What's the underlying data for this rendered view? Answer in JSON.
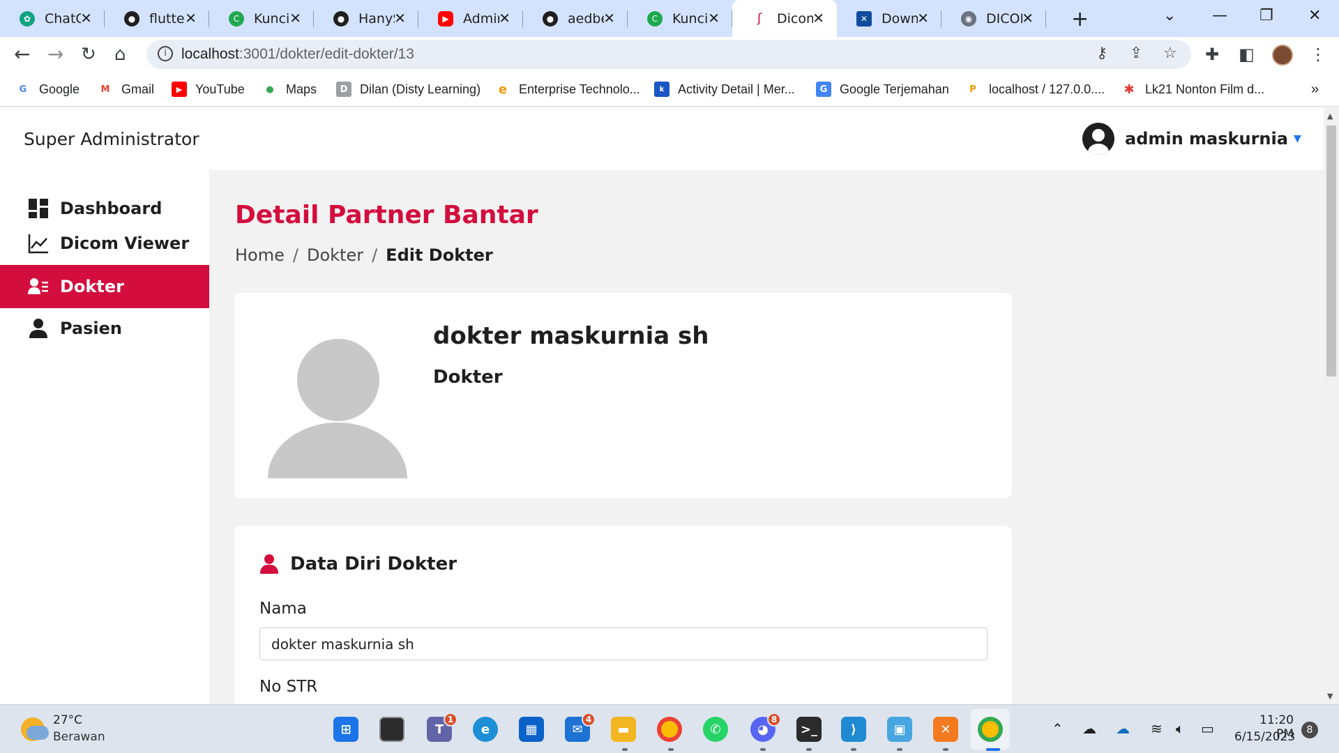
{
  "browser": {
    "tabs": [
      {
        "title": "ChatGPT",
        "icon": "chatgpt-icon",
        "color": "#10a37f"
      },
      {
        "title": "flutter-",
        "icon": "github-icon",
        "color": "#1f1f1f"
      },
      {
        "title": "Kunci Jawaban",
        "icon": "kunci-icon",
        "color": "#1fa84f"
      },
      {
        "title": "HanySu",
        "icon": "github-icon",
        "color": "#1f1f1f"
      },
      {
        "title": "Admin",
        "icon": "youtube-icon",
        "color": "#ff0000"
      },
      {
        "title": "aedbel",
        "icon": "github-icon",
        "color": "#1f1f1f"
      },
      {
        "title": "Kunci Jawaban",
        "icon": "kunci-icon",
        "color": "#1fa84f"
      },
      {
        "title": "Dicom",
        "icon": "dicom-icon",
        "color": "#d30d3d"
      },
      {
        "title": "Download",
        "icon": "download-icon",
        "color": "#0f4c9b"
      },
      {
        "title": "DICOM",
        "icon": "dicom-globe-icon",
        "color": "#6b7280"
      }
    ],
    "close_glyph": "✕",
    "new_tab_glyph": "+",
    "url_host": "localhost",
    "url_path": ":3001/dokter/edit-dokter/13",
    "info_glyph": "i",
    "bookmarks": [
      {
        "label": "Google",
        "icon": "google-icon",
        "glyph": "G",
        "color": "#4285f4"
      },
      {
        "label": "Gmail",
        "icon": "gmail-icon",
        "glyph": "M",
        "color": "#ea4335"
      },
      {
        "label": "YouTube",
        "icon": "youtube-icon",
        "glyph": "▶",
        "color": "#ff0000"
      },
      {
        "label": "Maps",
        "icon": "maps-icon",
        "glyph": "●",
        "color": "#34a853"
      },
      {
        "label": "Dilan (Disty Learning)",
        "icon": "dilan-icon",
        "glyph": "D",
        "color": "#6b6b6b"
      },
      {
        "label": "Enterprise Technolo...",
        "icon": "enterprise-icon",
        "glyph": "e",
        "color": "#f29900"
      },
      {
        "label": "Activity Detail | Mer...",
        "icon": "activity-icon",
        "glyph": "k",
        "color": "#1a56c4"
      },
      {
        "label": "Google Terjemahan",
        "icon": "translate-icon",
        "glyph": "G",
        "color": "#4285f4"
      },
      {
        "label": "localhost / 127.0.0....",
        "icon": "phpmyadmin-icon",
        "glyph": "P",
        "color": "#f29900"
      },
      {
        "label": "Lk21 Nonton Film d...",
        "icon": "lk21-icon",
        "glyph": "✱",
        "color": "#e53935"
      }
    ],
    "more_bookmarks_glyph": "»"
  },
  "app": {
    "brand": "Super Administrator",
    "user_name": "admin maskurnia",
    "colors": {
      "accent": "#d30d3d"
    },
    "sidebar": [
      {
        "label": "Dashboard",
        "icon": "dashboard-icon",
        "active": false
      },
      {
        "label": "Dicom Viewer",
        "icon": "chart-line-icon",
        "active": false
      },
      {
        "label": "Dokter",
        "icon": "user-list-icon",
        "active": true
      },
      {
        "label": "Pasien",
        "icon": "user-icon",
        "active": false
      }
    ],
    "page_title": "Detail Partner Bantar",
    "breadcrumb": [
      "Home",
      "Dokter",
      "Edit Dokter"
    ],
    "profile": {
      "name": "dokter maskurnia sh",
      "role": "Dokter"
    },
    "section_title": "Data Diri Dokter",
    "fields": [
      {
        "label": "Nama",
        "value": "dokter maskurnia sh"
      },
      {
        "label": "No STR",
        "value": ""
      }
    ]
  },
  "taskbar": {
    "weather_temp": "27°C",
    "weather_desc": "Berawan",
    "time": "11:20 PM",
    "date": "6/15/2023",
    "notifications": "8",
    "badges": {
      "teams": "1",
      "mail": "4",
      "discord": "8"
    }
  }
}
